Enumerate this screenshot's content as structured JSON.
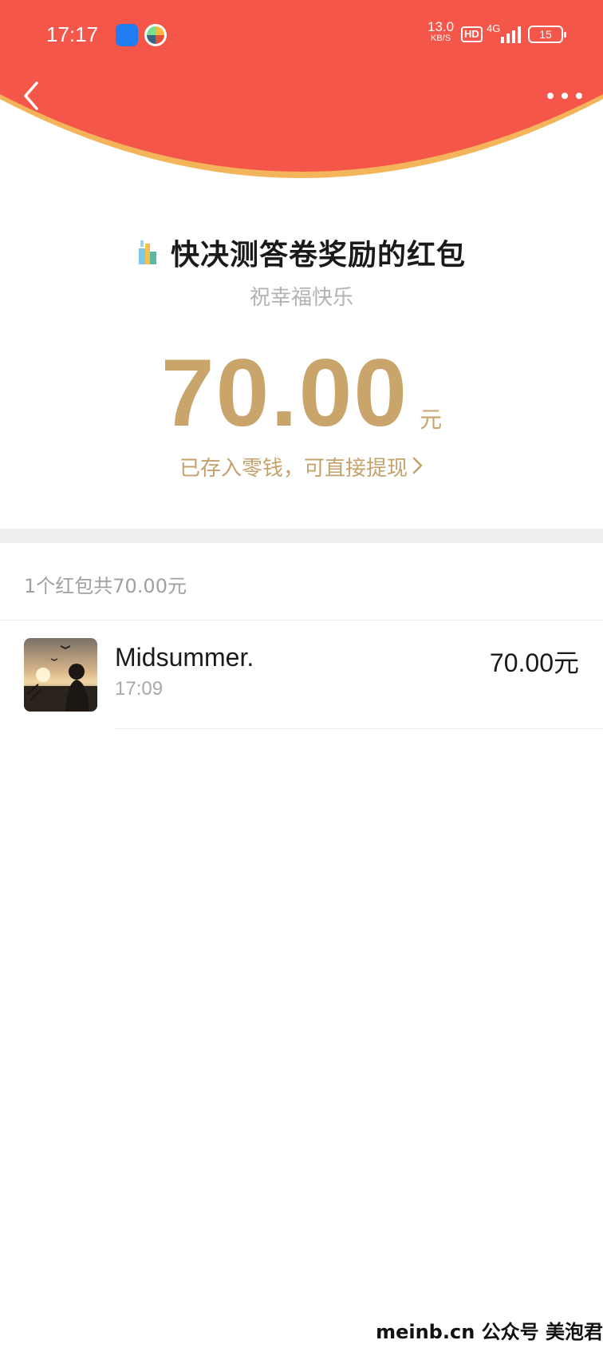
{
  "status_bar": {
    "time": "17:17",
    "net_speed_value": "13.0",
    "net_speed_unit": "KB/S",
    "hd_label": "HD",
    "network_type": "4G",
    "battery_level": "15"
  },
  "header": {
    "back_icon": "chevron-left-icon",
    "more_icon": "more-dots-icon",
    "color": "#f4574a",
    "rim_color": "#f3b45a"
  },
  "red_packet": {
    "title": "快决测答卷奖励的红包",
    "blessing": "祝幸福快乐",
    "amount": "70.00",
    "unit": "元",
    "stored_text": "已存入零钱，可直接提现",
    "accent_color": "#c9a46b"
  },
  "summary": {
    "text": "1个红包共70.00元"
  },
  "records": [
    {
      "name": "Midsummer.",
      "time": "17:09",
      "amount": "70.00元"
    }
  ],
  "watermark": "meinb.cn  公众号 美泡君"
}
